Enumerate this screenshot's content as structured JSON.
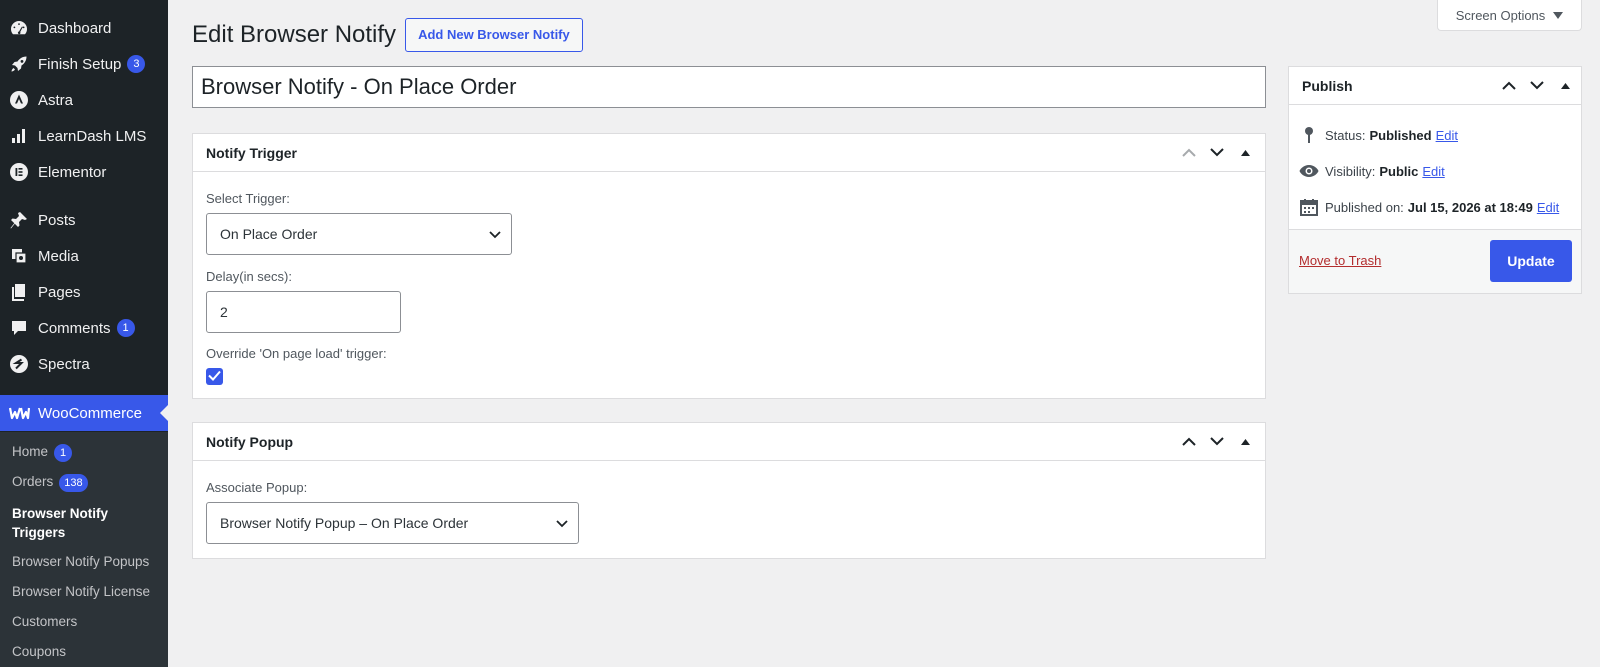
{
  "sidebar": {
    "items": [
      {
        "label": "Dashboard",
        "icon": "dashboard-icon"
      },
      {
        "label": "Finish Setup",
        "icon": "rocket-icon",
        "badge": "3"
      },
      {
        "label": "Astra",
        "icon": "astra-icon"
      },
      {
        "label": "LearnDash LMS",
        "icon": "bar-chart-icon"
      },
      {
        "label": "Elementor",
        "icon": "elementor-icon"
      },
      {
        "label": "Posts",
        "icon": "pin-icon"
      },
      {
        "label": "Media",
        "icon": "media-icon"
      },
      {
        "label": "Pages",
        "icon": "pages-icon"
      },
      {
        "label": "Comments",
        "icon": "comment-icon",
        "badge": "1"
      },
      {
        "label": "Spectra",
        "icon": "spectra-icon"
      },
      {
        "label": "WooCommerce",
        "icon": "woo-icon"
      }
    ],
    "submenu": [
      {
        "label": "Home",
        "badge": "1"
      },
      {
        "label": "Orders",
        "badge": "138"
      },
      {
        "label": "Browser Notify Triggers"
      },
      {
        "label": "Browser Notify Popups"
      },
      {
        "label": "Browser Notify License"
      },
      {
        "label": "Customers"
      },
      {
        "label": "Coupons"
      }
    ]
  },
  "header": {
    "title": "Edit Browser Notify",
    "add_new": "Add New Browser Notify",
    "screen_options": "Screen Options"
  },
  "post": {
    "title": "Browser Notify - On Place Order"
  },
  "trigger_box": {
    "title": "Notify Trigger",
    "select_label": "Select Trigger:",
    "select_value": "On Place Order",
    "delay_label": "Delay(in secs):",
    "delay_value": "2",
    "override_label": "Override 'On page load' trigger:",
    "override_checked": true
  },
  "popup_box": {
    "title": "Notify Popup",
    "associate_label": "Associate Popup:",
    "associate_value": "Browser Notify Popup – On Place Order"
  },
  "publish": {
    "title": "Publish",
    "status_label": "Status:",
    "status_value": "Published",
    "visibility_label": "Visibility:",
    "visibility_value": "Public",
    "published_label": "Published on:",
    "published_value": "Jul 15, 2026 at 18:49",
    "edit_label": "Edit",
    "trash_label": "Move to Trash",
    "update_label": "Update"
  },
  "colors": {
    "sidebar_bg": "#1d2327",
    "accent": "#3858e9",
    "trash": "#b32d2e"
  }
}
